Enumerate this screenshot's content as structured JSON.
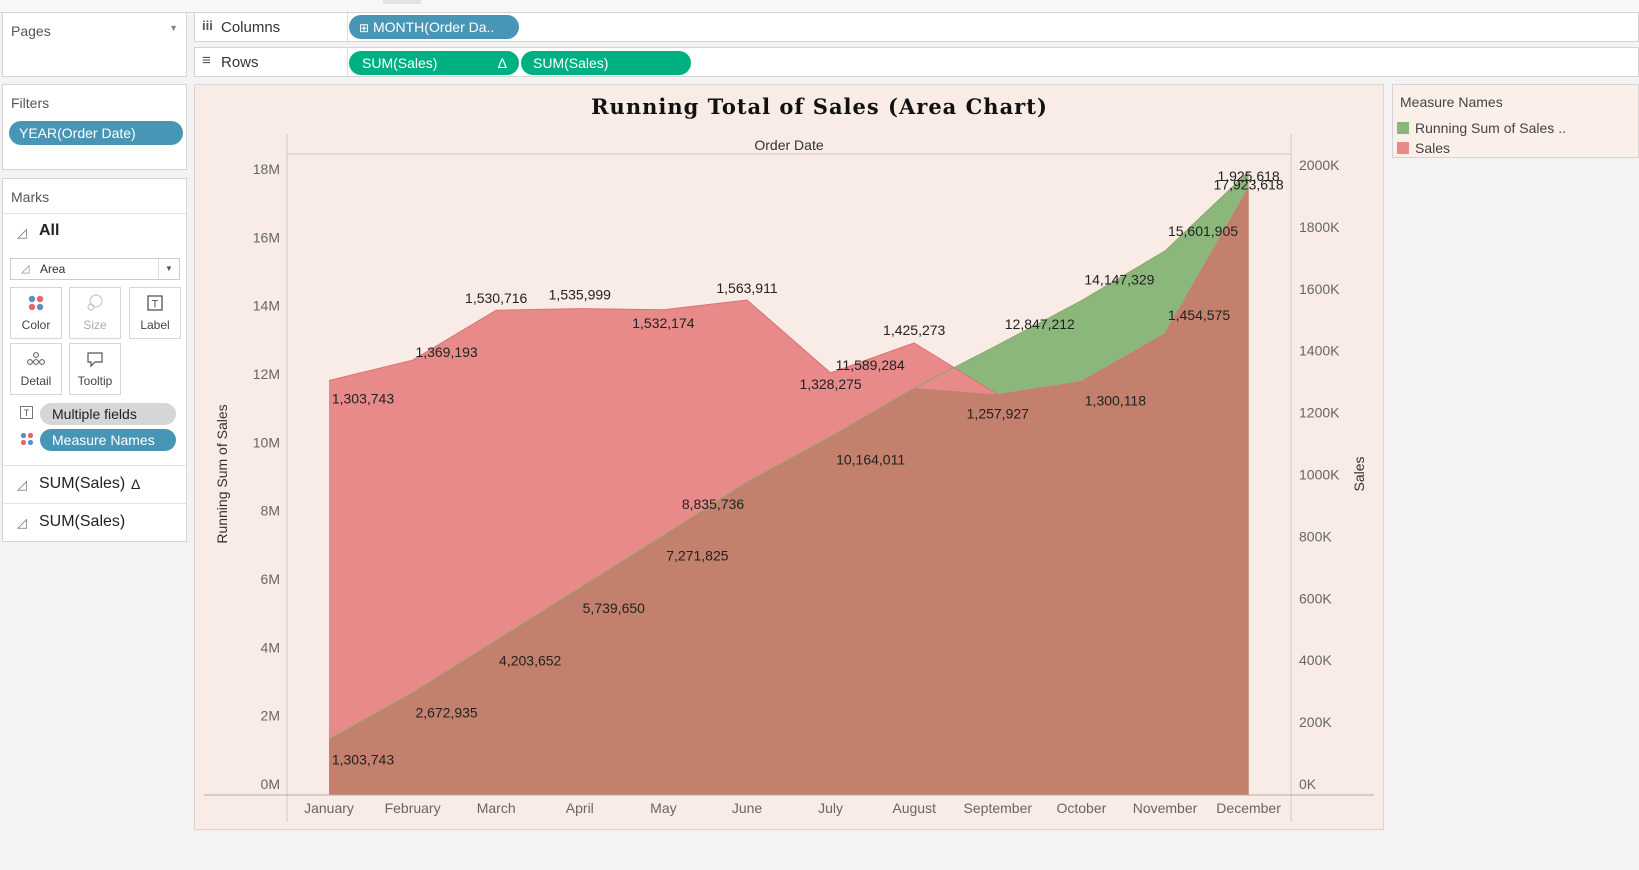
{
  "shelves": {
    "pages_title": "Pages",
    "filters_title": "Filters",
    "filter_pill": "YEAR(Order Date)",
    "columns_label": "Columns",
    "columns_pill": "MONTH(Order Da..",
    "rows_label": "Rows",
    "rows_pill_1": "SUM(Sales)",
    "rows_pill_1_delta": "Δ",
    "rows_pill_2": "SUM(Sales)"
  },
  "marks": {
    "title": "Marks",
    "all_label": "All",
    "mark_type": "Area",
    "buttons": {
      "color": "Color",
      "size": "Size",
      "label": "Label",
      "detail": "Detail",
      "tooltip": "Tooltip"
    },
    "fields": {
      "multiple": "Multiple fields",
      "measure_names": "Measure Names"
    },
    "cards": [
      "SUM(Sales)",
      "SUM(Sales)"
    ],
    "card_delta": "Δ"
  },
  "legend": {
    "title": "Measure Names",
    "items": [
      {
        "label": "Running Sum of Sales ..",
        "color": "#8bb77b"
      },
      {
        "label": "Sales",
        "color": "#e8898a"
      }
    ]
  },
  "colors": {
    "running_fill": "#8bb77b",
    "sales_fill": "#e8898a",
    "overlap_fill": "#c3806c",
    "panel_bg": "#f9ece6"
  },
  "chart_data": {
    "type": "area",
    "title": "Running Total of Sales (Area Chart)",
    "column_header": "Order Date",
    "xlabel": "",
    "ylabel_left": "Running Sum of Sales",
    "ylabel_right": "Sales",
    "categories": [
      "January",
      "February",
      "March",
      "April",
      "May",
      "June",
      "July",
      "August",
      "September",
      "October",
      "November",
      "December"
    ],
    "ylim_left": [
      0,
      18000000
    ],
    "ylim_right": [
      0,
      2000000
    ],
    "yticks_left": [
      "0M",
      "2M",
      "4M",
      "6M",
      "8M",
      "10M",
      "12M",
      "14M",
      "16M",
      "18M"
    ],
    "yticks_right": [
      "0K",
      "200K",
      "400K",
      "600K",
      "800K",
      "1000K",
      "1200K",
      "1400K",
      "1600K",
      "1800K",
      "2000K"
    ],
    "series": [
      {
        "name": "Running Sum of Sales ..",
        "axis": "left",
        "values": [
          1303743,
          2672935,
          4203652,
          5739650,
          7271825,
          8835736,
          10164011,
          11589284,
          12847212,
          14147329,
          15601905,
          17923618
        ],
        "labels": [
          "1,303,743",
          "2,672,935",
          "4,203,652",
          "5,739,650",
          "7,271,825",
          "8,835,736",
          "10,164,011",
          "11,589,284",
          "12,847,212",
          "14,147,329",
          "15,601,905",
          "17,923,618"
        ]
      },
      {
        "name": "Sales",
        "axis": "right",
        "values": [
          1303743,
          1369193,
          1530716,
          1535999,
          1532174,
          1563911,
          1328275,
          1425273,
          1257927,
          1300118,
          1454575,
          1925618
        ],
        "labels": [
          "1,303,743",
          "1,369,193",
          "1,530,716",
          "1,535,999",
          "1,532,174",
          "1,563,911",
          "1,328,275",
          "1,425,273",
          "1,257,927",
          "1,300,118",
          "1,454,575",
          "1,925,618"
        ]
      }
    ],
    "grid": false,
    "legend_position": "right"
  }
}
